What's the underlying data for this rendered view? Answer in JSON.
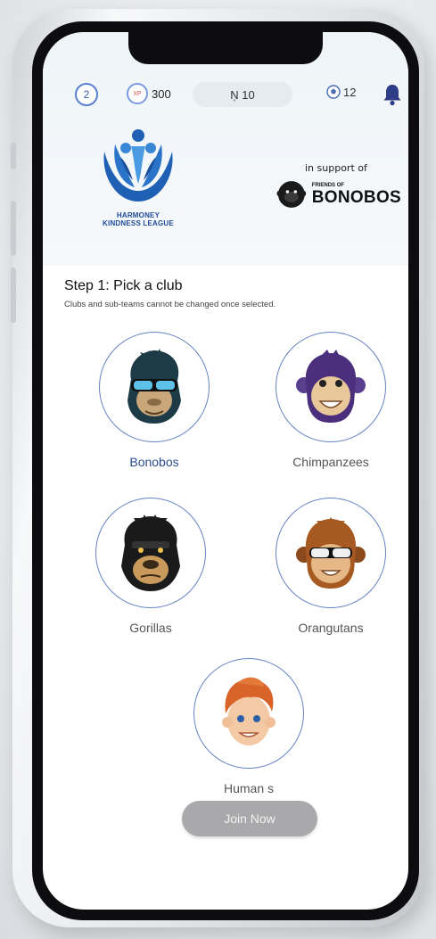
{
  "header": {
    "level": "2",
    "xp_label": "XP",
    "xp_value": "300",
    "steps": "Ņ 10",
    "balls": "12"
  },
  "logos": {
    "league_name_line1": "HARMONEY",
    "league_name_line2": "KINDNESS LEAGUE",
    "support_text": "in support of",
    "friends_of": "FRIENDS OF",
    "bonobos": "BONOBOS"
  },
  "step": {
    "title": "Step 1: Pick a club",
    "subtitle": "Clubs and sub-teams cannot be changed once selected."
  },
  "clubs": [
    {
      "label": "Bonobos",
      "icon": "bonobo-icon"
    },
    {
      "label": "Chimpanzees",
      "icon": "chimpanzee-icon"
    },
    {
      "label": "Gorillas",
      "icon": "gorilla-icon"
    },
    {
      "label": "Orangutans",
      "icon": "orangutan-icon"
    },
    {
      "label": "Human s",
      "icon": "human-icon"
    }
  ],
  "join_button": "Join Now",
  "colors": {
    "accent": "#2b4a8c",
    "button_disabled": "#a9a9ab",
    "ring": "#6682c4"
  }
}
